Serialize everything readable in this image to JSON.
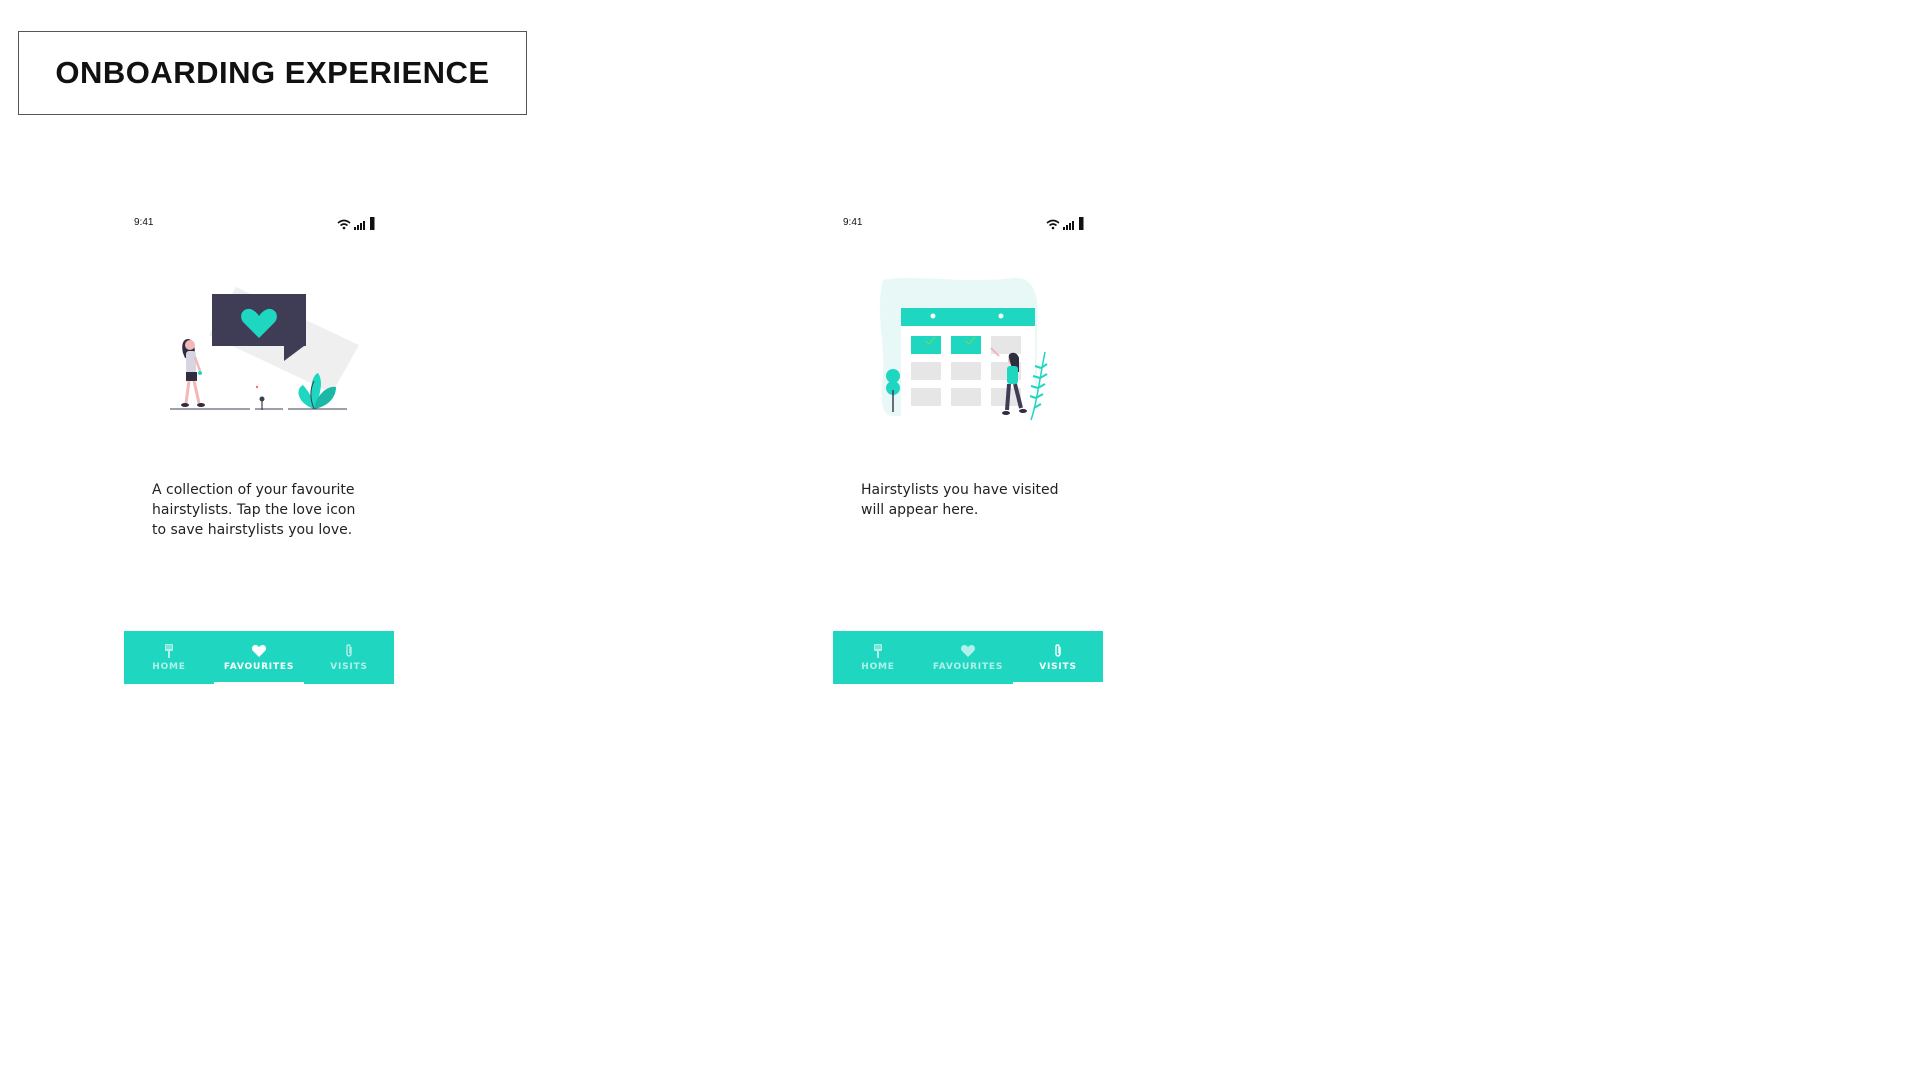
{
  "header": {
    "title": "ONBOARDING EXPERIENCE"
  },
  "colors": {
    "accent": "#1fd6c1",
    "dark": "#3f3d56",
    "pink": "#f3b7b7"
  },
  "screens": [
    {
      "status_time": "9:41",
      "description": "A collection of your favourite hairstylists. Tap the love icon to save hairstylists you love.",
      "illustration": "favourites-illustration",
      "tabs": [
        {
          "label": "HOME",
          "icon": "comb-icon",
          "active": false
        },
        {
          "label": "FAVOURITES",
          "icon": "heart-icon",
          "active": true
        },
        {
          "label": "VISITS",
          "icon": "paperclip-icon",
          "active": false
        }
      ]
    },
    {
      "status_time": "9:41",
      "description": "Hairstylists you have visited will appear here.",
      "illustration": "calendar-illustration",
      "tabs": [
        {
          "label": "HOME",
          "icon": "comb-icon",
          "active": false
        },
        {
          "label": "FAVOURITES",
          "icon": "heart-icon",
          "active": false
        },
        {
          "label": "VISITS",
          "icon": "paperclip-icon",
          "active": true
        }
      ]
    }
  ]
}
